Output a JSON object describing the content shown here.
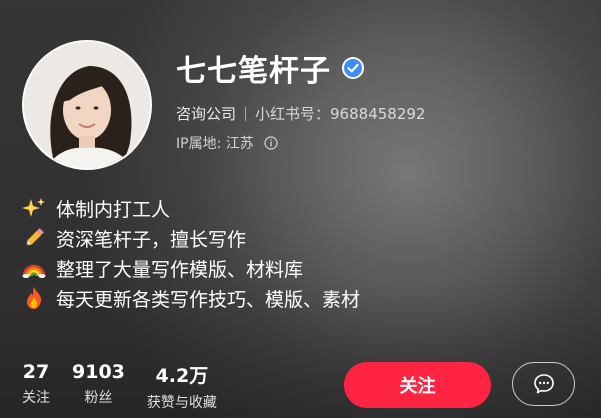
{
  "profile": {
    "name": "七七笔杆子",
    "category": "咨询公司",
    "id_text": "小红书号：9688458292",
    "ip_location": "IP属地: 江苏"
  },
  "bio": [
    {
      "icon": "sparkles-icon",
      "text": "体制内打工人"
    },
    {
      "icon": "pencil-icon",
      "text": "资深笔杆子，擅长写作"
    },
    {
      "icon": "rainbow-icon",
      "text": "整理了大量写作模版、材料库"
    },
    {
      "icon": "fire-icon",
      "text": "每天更新各类写作技巧、模版、素材"
    }
  ],
  "stats": [
    {
      "value": "27",
      "label": "关注"
    },
    {
      "value": "9103",
      "label": "粉丝"
    },
    {
      "value": "4.2万",
      "label": "获赞与收藏"
    }
  ],
  "actions": {
    "follow_label": "关注",
    "message_icon": "chat-bubble-icon"
  },
  "colors": {
    "accent": "#ff2442",
    "verified": "#3d8bfd"
  }
}
